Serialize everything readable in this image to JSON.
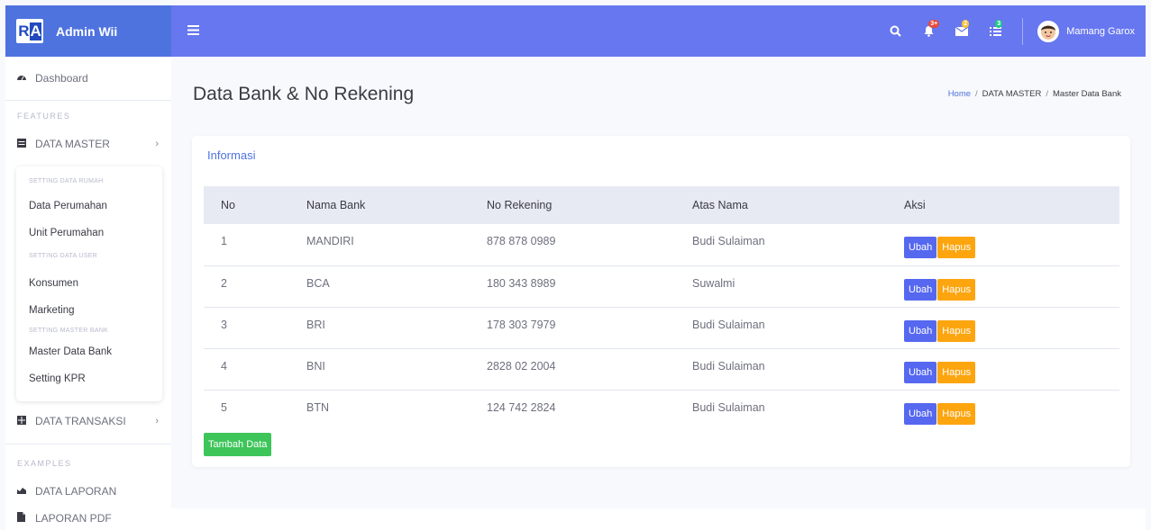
{
  "brand": {
    "logo_r": "R",
    "logo_a": "A",
    "name": "Admin Wii"
  },
  "topbar": {
    "badges": {
      "alerts": "3+",
      "messages": "2",
      "tasks": "3"
    },
    "user_name": "Mamang Garox"
  },
  "sidebar": {
    "dashboard": "Dashboard",
    "features_heading": "FEATURES",
    "data_master": "DATA MASTER",
    "submenu": {
      "heading_rumah": "SETTING DATA RUMAH",
      "data_perumahan": "Data Perumahan",
      "unit_perumahan": "Unit Perumahan",
      "heading_user": "SETTING DATA USER",
      "konsumen": "Konsumen",
      "marketing": "Marketing",
      "heading_bank": "SETTING MASTER BANK",
      "master_data_bank": "Master Data Bank",
      "setting_kpr": "Setting KPR"
    },
    "data_transaksi": "DATA TRANSAKSI",
    "examples_heading": "EXAMPLES",
    "data_laporan": "DATA LAPORAN",
    "laporan_pdf": "LAPORAN PDF"
  },
  "page": {
    "title": "Data Bank & No Rekening",
    "breadcrumb": {
      "home": "Home",
      "section": "DATA MASTER",
      "current": "Master Data Bank",
      "sep": "/"
    }
  },
  "card": {
    "title": "Informasi",
    "columns": {
      "no": "No",
      "bank": "Nama Bank",
      "rekening": "No Rekening",
      "atas_nama": "Atas Nama",
      "aksi": "Aksi"
    },
    "rows": [
      {
        "no": "1",
        "bank": "MANDIRI",
        "rekening": "878 878 0989",
        "atas_nama": "Budi Sulaiman"
      },
      {
        "no": "2",
        "bank": "BCA",
        "rekening": "180 343 8989",
        "atas_nama": "Suwalmi"
      },
      {
        "no": "3",
        "bank": "BRI",
        "rekening": "178 303 7979",
        "atas_nama": "Budi Sulaiman"
      },
      {
        "no": "4",
        "bank": "BNI",
        "rekening": "2828 02 2004",
        "atas_nama": "Budi Sulaiman"
      },
      {
        "no": "5",
        "bank": "BTN",
        "rekening": "124 742 2824",
        "atas_nama": "Budi Sulaiman"
      }
    ],
    "ubah_label": "Ubah",
    "hapus_label": "Hapus",
    "tambah_label": "Tambah Data"
  },
  "colors": {
    "primary": "#6777ef",
    "brand": "#4e73df",
    "warning": "#fda50f",
    "success": "#3ec55a"
  }
}
